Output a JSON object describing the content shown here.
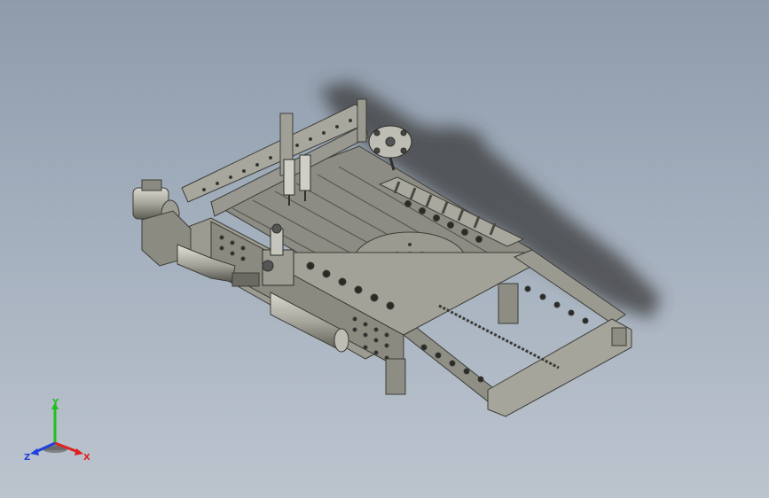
{
  "viewport": {
    "background_top": "#8d9bab",
    "background_bottom": "#bcc4ce",
    "model_color": "#8f8f86",
    "shadow_color": "#3a3a3a"
  },
  "triad": {
    "x_label": "X",
    "y_label": "Y",
    "z_label": "Z",
    "x_color": "#e02020",
    "y_color": "#20c020",
    "z_color": "#2040e0"
  }
}
